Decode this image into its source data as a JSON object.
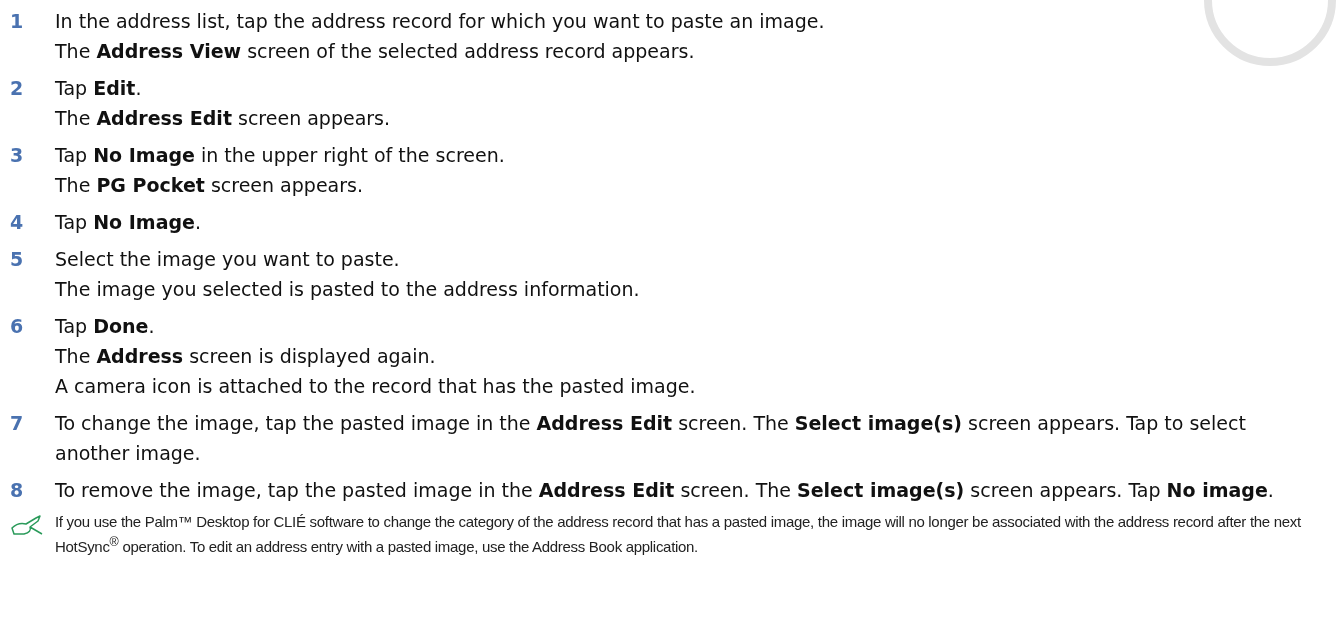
{
  "steps": [
    {
      "number": "1",
      "lines": [
        "In the address list, tap the address record for which you want to paste an image.",
        "The **Address View** screen of the selected address record appears."
      ]
    },
    {
      "number": "2",
      "lines": [
        "Tap **Edit**.",
        "The **Address Edit** screen appears."
      ]
    },
    {
      "number": "3",
      "lines": [
        "Tap **No Image** in the upper right of the screen.",
        "The **PG Pocket** screen appears."
      ]
    },
    {
      "number": "4",
      "lines": [
        "Tap **No Image**."
      ]
    },
    {
      "number": "5",
      "lines": [
        "Select the image you want to paste.",
        "The image you selected is pasted to the address information."
      ]
    },
    {
      "number": "6",
      "lines": [
        "Tap **Done**.",
        "The **Address** screen is displayed again.",
        "A camera icon is attached to the record that has the pasted image."
      ]
    },
    {
      "number": "7",
      "lines": [
        "To change the image, tap the pasted image in the **Address Edit** screen. The **Select image(s)** screen appears. Tap to select another image."
      ]
    },
    {
      "number": "8",
      "lines": [
        "To remove the image, tap the pasted image in the **Address Edit** screen. The **Select image(s)** screen appears. Tap **No image**."
      ]
    }
  ],
  "note": {
    "text": "If you use the Palm™ Desktop for CLIÉ software to change the category of the address record that has a pasted image, the image will no longer be associated with the address record after the next HotSync$^{®}$ operation. To edit an address entry with a pasted image, use the Address Book application."
  }
}
